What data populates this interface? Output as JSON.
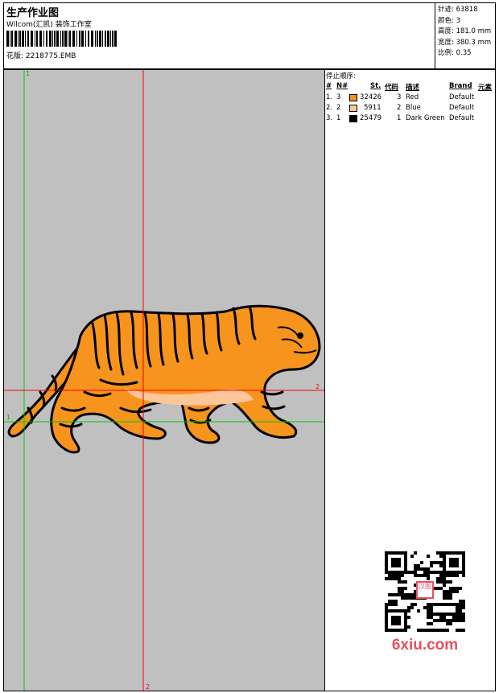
{
  "header": {
    "title": "生产作业图",
    "studio": "Wilcom(汇凯) 装饰工作室",
    "filename": "花版: 2218775.EMB",
    "stats": [
      {
        "label": "针迹:",
        "value": "63818"
      },
      {
        "label": "颜色:",
        "value": "3"
      },
      {
        "label": "高度:",
        "value": "181.0 mm"
      },
      {
        "label": "宽度:",
        "value": "380.3 mm"
      },
      {
        "label": "比例:",
        "value": "0.35"
      }
    ]
  },
  "stop_sequence": {
    "title": "停止顺序:",
    "columns": [
      "#",
      "N#",
      "St.",
      "代码",
      "描述",
      "Brand",
      "元素"
    ],
    "rows": [
      {
        "index": "1.",
        "n": "3",
        "color": "#f7941d",
        "stitches": "32426",
        "code": "3",
        "desc": "Red",
        "brand": "Default"
      },
      {
        "index": "2.",
        "n": "2",
        "color": "#fbc79a",
        "stitches": "5911",
        "code": "2",
        "desc": "Blue",
        "brand": "Default"
      },
      {
        "index": "3.",
        "n": "1",
        "color": "#000000",
        "stitches": "25479",
        "code": "1",
        "desc": "Dark Green",
        "brand": "Default"
      }
    ]
  },
  "guides": {
    "green_label_top": "1",
    "green_label_left": "1",
    "red_label_right": "2",
    "red_label_bottom": "2"
  },
  "watermark": {
    "stamp": "汉图",
    "text": "6xiu.com"
  }
}
